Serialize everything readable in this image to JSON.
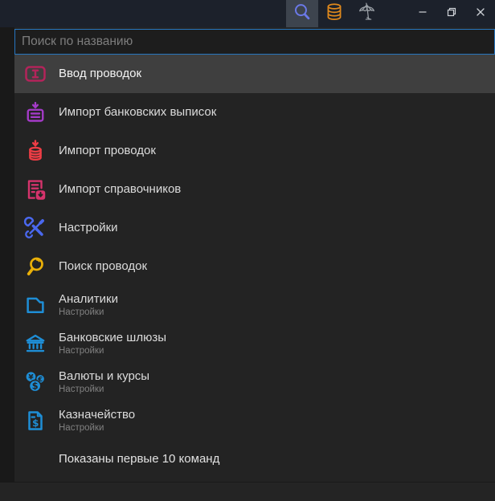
{
  "titlebar": {
    "tools": [
      {
        "name": "search-tool",
        "icon": "search-icon",
        "active": true,
        "color": "#6b79e8"
      },
      {
        "name": "database-tool",
        "icon": "database-icon",
        "active": false,
        "color": "#e0891c"
      },
      {
        "name": "umbrella-tool",
        "icon": "umbrella-icon",
        "active": false,
        "color": "#9aa0a6"
      }
    ],
    "window_controls": [
      {
        "name": "minimize",
        "icon": "minimize-icon"
      },
      {
        "name": "restore",
        "icon": "restore-icon"
      },
      {
        "name": "close",
        "icon": "close-icon"
      }
    ]
  },
  "search": {
    "placeholder": "Поиск по названию",
    "value": "",
    "border_color": "#2776c0"
  },
  "commands": [
    {
      "label": "Ввод проводок",
      "icon": "text-input-icon",
      "color": "#b3245a",
      "selected": true
    },
    {
      "label": "Импорт банковских выписок",
      "icon": "import-card-icon",
      "color": "#a43bc8",
      "selected": false
    },
    {
      "label": "Импорт проводок",
      "icon": "import-database-icon",
      "color": "#ee3d45",
      "selected": false
    },
    {
      "label": "Импорт справочников",
      "icon": "import-document-icon",
      "color": "#d6336c",
      "selected": false
    },
    {
      "label": "Настройки",
      "icon": "tools-icon",
      "color": "#4a68ee",
      "selected": false
    },
    {
      "label": "Поиск проводок",
      "icon": "magnifier-icon",
      "color": "#eab008",
      "selected": false
    },
    {
      "label": "Аналитики",
      "sublabel": "Настройки",
      "icon": "folder-icon",
      "color": "#1e8ed6",
      "selected": false
    },
    {
      "label": "Банковские шлюзы",
      "sublabel": "Настройки",
      "icon": "bank-icon",
      "color": "#1e8ed6",
      "selected": false
    },
    {
      "label": "Валюты и курсы",
      "sublabel": "Настройки",
      "icon": "currencies-icon",
      "color": "#1e8ed6",
      "selected": false
    },
    {
      "label": "Казначейство",
      "sublabel": "Настройки",
      "icon": "treasury-icon",
      "color": "#1e8ed6",
      "selected": false
    }
  ],
  "footer": {
    "text": "Показаны первые 10 команд"
  },
  "colors": {
    "titlebar_bg": "#1c212b",
    "panel_bg": "#232323",
    "selected_row_bg": "#3f3f3f",
    "window_bg": "#242424",
    "accent_border": "#2776c0"
  }
}
